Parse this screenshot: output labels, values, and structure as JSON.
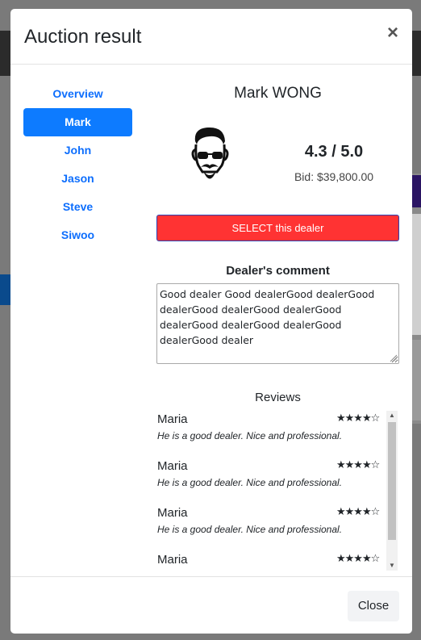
{
  "modal": {
    "title": "Auction result",
    "close_symbol": "×"
  },
  "sidebar": {
    "items": [
      {
        "label": "Overview",
        "active": false
      },
      {
        "label": "Mark",
        "active": true
      },
      {
        "label": "John",
        "active": false
      },
      {
        "label": "Jason",
        "active": false
      },
      {
        "label": "Steve",
        "active": false
      },
      {
        "label": "Siwoo",
        "active": false
      }
    ]
  },
  "dealer": {
    "name": "Mark WONG",
    "avatar_icon": "hipster-avatar-icon",
    "rating": "4.3 / 5.0",
    "bid": "Bid: $39,800.00",
    "select_label": "SELECT this dealer",
    "select_color": "#ff3333",
    "comment_heading": "Dealer's comment",
    "comment": "Good dealer Good dealerGood dealerGood dealerGood dealerGood dealerGood dealerGood dealerGood dealerGood dealerGood dealer"
  },
  "reviews": {
    "heading": "Reviews",
    "items": [
      {
        "name": "Maria",
        "stars": "★★★★☆",
        "text": "He is a good dealer. Nice and professional."
      },
      {
        "name": "Maria",
        "stars": "★★★★☆",
        "text": "He is a good dealer. Nice and professional."
      },
      {
        "name": "Maria",
        "stars": "★★★★☆",
        "text": "He is a good dealer. Nice and professional."
      },
      {
        "name": "Maria",
        "stars": "★★★★☆",
        "text": ""
      }
    ]
  },
  "footer": {
    "close_label": "Close"
  }
}
